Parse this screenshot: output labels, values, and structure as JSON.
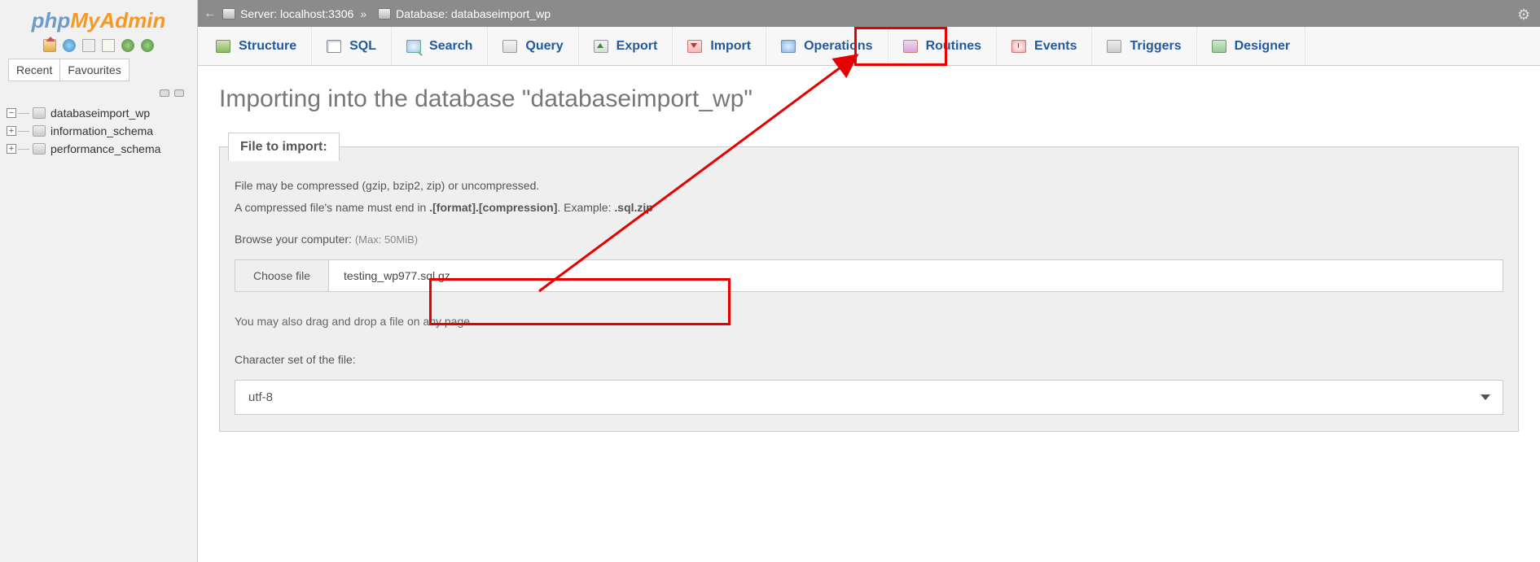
{
  "logo": {
    "part1": "php",
    "part2": "MyAdmin"
  },
  "sidebar": {
    "recent": "Recent",
    "favourites": "Favourites",
    "databases": [
      {
        "name": "databaseimport_wp",
        "toggle": "−"
      },
      {
        "name": "information_schema",
        "toggle": "+"
      },
      {
        "name": "performance_schema",
        "toggle": "+"
      }
    ]
  },
  "breadcrumbs": {
    "server_label": "Server: localhost:3306",
    "database_label": "Database: databaseimport_wp",
    "sep": "»"
  },
  "tabs": {
    "structure": "Structure",
    "sql": "SQL",
    "search": "Search",
    "query": "Query",
    "export": "Export",
    "import": "Import",
    "operations": "Operations",
    "routines": "Routines",
    "events": "Events",
    "triggers": "Triggers",
    "designer": "Designer"
  },
  "heading": "Importing into the database \"databaseimport_wp\"",
  "file_section": {
    "legend": "File to import:",
    "line1": "File may be compressed (gzip, bzip2, zip) or uncompressed.",
    "line2_prefix": "A compressed file's name must end in ",
    "line2_bold": ".[format].[compression]",
    "line2_mid": ". Example: ",
    "line2_example": ".sql.zip",
    "browse_label": "Browse your computer: ",
    "max_label": "(Max: 50MiB)",
    "choose_btn": "Choose file",
    "chosen_file": "testing_wp977.sql.gz",
    "drag_note": "You may also drag and drop a file on any page.",
    "charset_label": "Character set of the file:",
    "charset_value": "utf-8"
  }
}
